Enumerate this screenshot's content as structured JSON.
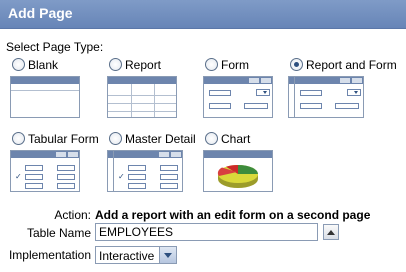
{
  "header": {
    "title": "Add Page"
  },
  "page_type": {
    "label": "Select Page Type:",
    "options": [
      {
        "label": "Blank",
        "checked": false
      },
      {
        "label": "Report",
        "checked": false
      },
      {
        "label": "Form",
        "checked": false
      },
      {
        "label": "Report and Form",
        "checked": true
      },
      {
        "label": "Tabular Form",
        "checked": false
      },
      {
        "label": "Master Detail",
        "checked": false
      },
      {
        "label": "Chart",
        "checked": false
      }
    ]
  },
  "action": {
    "label": "Action:",
    "text": "Add a report with an edit form on a second page"
  },
  "table_name": {
    "label": "Table Name",
    "value": "EMPLOYEES"
  },
  "implementation": {
    "label": "Implementation",
    "value": "Interactive"
  },
  "colors": {
    "header": "#6f8cbb",
    "accent": "#2d4f7e"
  }
}
